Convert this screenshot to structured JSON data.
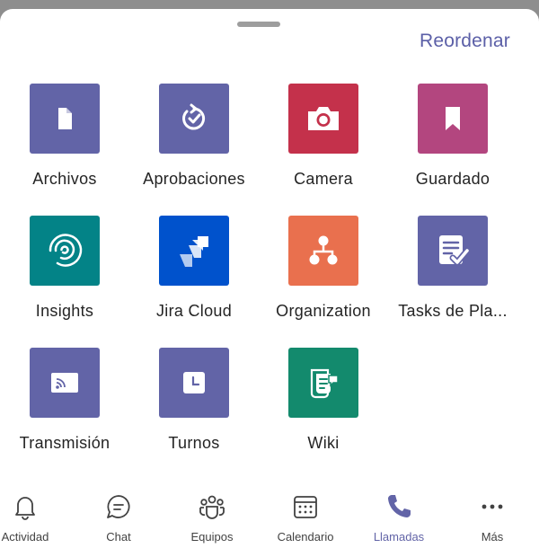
{
  "header": {
    "reorder_label": "Reordenar"
  },
  "apps": [
    {
      "label": "Archivos",
      "icon": "file-icon",
      "color": "#6264a7"
    },
    {
      "label": "Aprobaciones",
      "icon": "approval-icon",
      "color": "#6264a7"
    },
    {
      "label": "Camera",
      "icon": "camera-icon",
      "color": "#c4314b"
    },
    {
      "label": "Guardado",
      "icon": "bookmark-icon",
      "color": "#b3467f"
    },
    {
      "label": "Insights",
      "icon": "insights-icon",
      "color": "#038387"
    },
    {
      "label": "Jira Cloud",
      "icon": "jira-icon",
      "color": "#0052cc"
    },
    {
      "label": "Organization",
      "icon": "org-chart-icon",
      "color": "#e9704e"
    },
    {
      "label": "Tasks de Pla...",
      "icon": "tasks-icon",
      "color": "#6264a7"
    },
    {
      "label": "Transmisión",
      "icon": "stream-icon",
      "color": "#6264a7"
    },
    {
      "label": "Turnos",
      "icon": "clock-icon",
      "color": "#6264a7"
    },
    {
      "label": "Wiki",
      "icon": "wiki-icon",
      "color": "#138a6d"
    }
  ],
  "bottom_nav": {
    "items": [
      {
        "label": "Actividad",
        "icon": "bell-icon"
      },
      {
        "label": "Chat",
        "icon": "chat-icon"
      },
      {
        "label": "Equipos",
        "icon": "teams-icon"
      },
      {
        "label": "Calendario",
        "icon": "calendar-icon"
      },
      {
        "label": "Llamadas",
        "icon": "phone-icon",
        "color": "#6264a7"
      },
      {
        "label": "Más",
        "icon": "more-icon"
      }
    ]
  }
}
